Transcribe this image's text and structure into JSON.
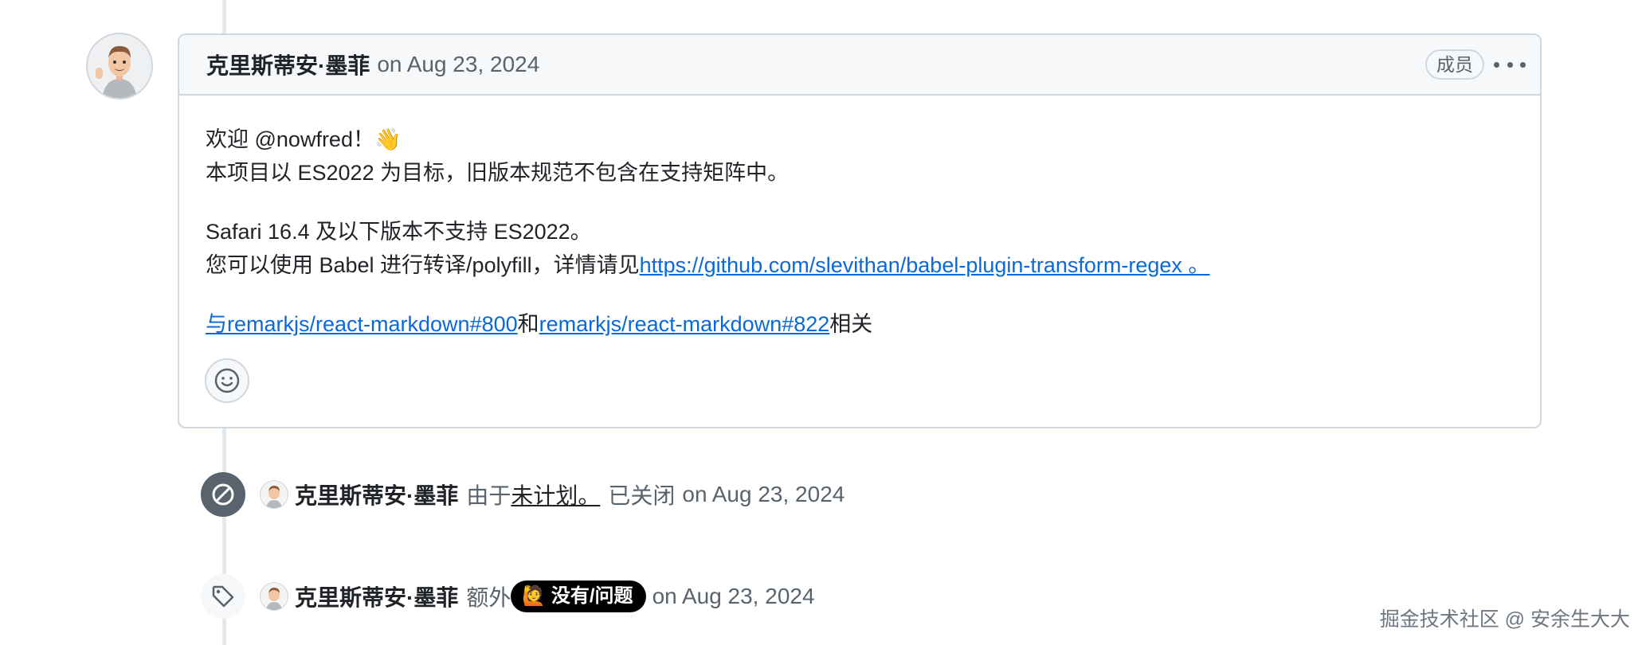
{
  "comment": {
    "author": "克里斯蒂安·墨菲",
    "date": "on Aug 23, 2024",
    "role_badge": "成员",
    "lines": {
      "welcome": "欢迎 @nowfred！👋",
      "target": "本项目以 ES2022 为目标，旧版本规范不包含在支持矩阵中。",
      "safari": "Safari 16.4 及以下版本不支持 ES2022。",
      "babel_prefix": "您可以使用 Babel 进行转译/polyfill，详情请见",
      "babel_link": "https://github.com/slevithan/babel-plugin-transform-regex 。",
      "related_prefix": "与",
      "related_link1": "remarkjs/react-markdown#800",
      "related_and": "和",
      "related_link2": "remarkjs/react-markdown#822",
      "related_suffix": "相关"
    }
  },
  "events": [
    {
      "icon": "closed-not-planned-icon",
      "author": "克里斯蒂安·墨菲",
      "prefix": "由于",
      "reason": "未计划。",
      "action": "已关闭",
      "date": "on Aug 23, 2024"
    },
    {
      "icon": "tag-icon",
      "author": "克里斯蒂安·墨菲",
      "prefix": "额外",
      "label": "🙋 没有/问题",
      "date": "on Aug 23, 2024"
    }
  ],
  "watermark": "掘金技术社区 @ 安余生大大"
}
